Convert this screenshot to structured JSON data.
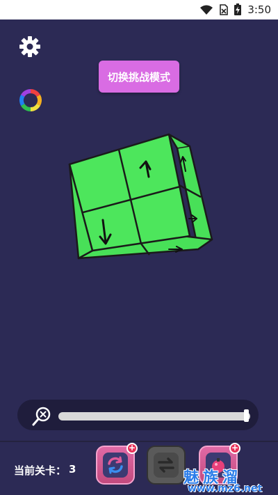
{
  "status_bar": {
    "time": "3:50",
    "icons": [
      "wifi-icon",
      "no-sim-icon",
      "battery-charging-icon"
    ]
  },
  "toolbar": {
    "settings_icon": "gear-icon",
    "color_icon": "color-wheel-icon",
    "challenge_button_label": "切换挑战模式"
  },
  "puzzle": {
    "cube_color": "#4de65c",
    "front_tiles": [
      "up-arrow",
      "blank",
      "down-arrow",
      "blank"
    ],
    "side_arrows": [
      "up-arrow",
      "right-arrow"
    ],
    "bottom_arrows": [
      "right-arrow"
    ]
  },
  "zoom_slider": {
    "icon": "zoom-reset-icon",
    "value": 1.0
  },
  "footer": {
    "level_label": "当前关卡：",
    "level_value": "3",
    "buttons": [
      "refresh-icon",
      "swap-icon",
      "bomb-icon"
    ]
  },
  "watermark": {
    "text": "魅族溜",
    "url": "www.mz6.net"
  }
}
